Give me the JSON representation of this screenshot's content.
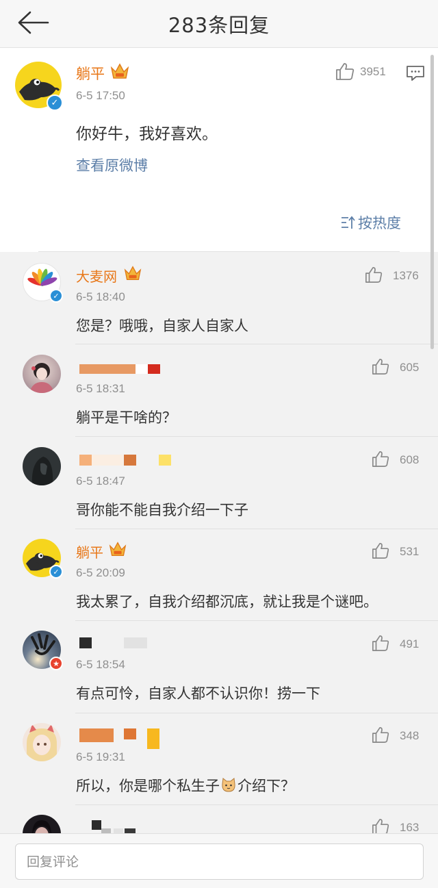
{
  "header": {
    "title": "283条回复"
  },
  "main_comment": {
    "user": "躺平",
    "time": "6-5 17:50",
    "likes": "3951",
    "text": "你好牛，我好喜欢。",
    "view_original": "查看原微博",
    "sort_label": "按热度"
  },
  "replies": [
    {
      "user": "大麦网",
      "time": "6-5 18:40",
      "likes": "1376",
      "text": "您是？哦哦，自家人自家人"
    },
    {
      "user": "",
      "time": "6-5 18:31",
      "likes": "605",
      "text": "躺平是干啥的？"
    },
    {
      "user": "",
      "time": "6-5 18:47",
      "likes": "608",
      "text": "哥你能不能自我介绍一下子"
    },
    {
      "user": "躺平",
      "time": "6-5 20:09",
      "likes": "531",
      "text": "我太累了，自我介绍都沉底，就让我是个谜吧。"
    },
    {
      "user": "",
      "time": "6-5 18:54",
      "likes": "491",
      "text": "有点可怜，自家人都不认识你！捞一下"
    },
    {
      "user": "",
      "time": "6-5 19:31",
      "likes": "348",
      "text": "所以，你是哪个私生子",
      "text_after": "介绍下？"
    },
    {
      "user": "",
      "time": "",
      "likes": "163",
      "text": ""
    }
  ],
  "reply_box": {
    "placeholder": "回复评论"
  },
  "colors": {
    "username": "#e8781a",
    "link": "#5d7fa8",
    "verified_badge": "#2a8fd6",
    "crown": "#f2b53a"
  }
}
